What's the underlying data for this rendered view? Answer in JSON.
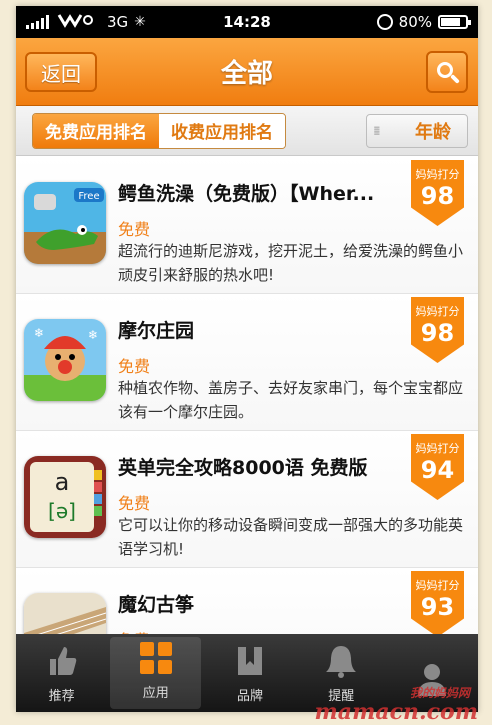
{
  "status_bar": {
    "carrier": "ﾞ",
    "network": "3G",
    "time": "14:28",
    "battery": "80%",
    "battery_level": 0.8
  },
  "header": {
    "back_label": "返回",
    "title": "全部"
  },
  "segments": {
    "free_label": "免费应用排名",
    "paid_label": "收费应用排名",
    "age_label": "年龄"
  },
  "apps": [
    {
      "name": "鳄鱼洗澡（免费版）【Wher...",
      "price": "免费",
      "description": "超流行的迪斯尼游戏，挖开泥土，给爱洗澡的鳄鱼小顽皮引来舒服的热水吧!",
      "score_label": "妈妈打分",
      "score": "98",
      "icon_badge": "Free"
    },
    {
      "name": "摩尔庄园",
      "price": "免费",
      "description": "种植农作物、盖房子、去好友家串门，每个宝宝都应该有一个摩尔庄园。",
      "score_label": "妈妈打分",
      "score": "98"
    },
    {
      "name": "英单完全攻略8000语 免费版",
      "price": "免费",
      "description": "它可以让你的移动设备瞬间变成一部强大的多功能英语学习机!",
      "score_label": "妈妈打分",
      "score": "94",
      "icon_letter": "a",
      "icon_phonetic": "[ə]"
    },
    {
      "name": "魔幻古筝",
      "price": "免费",
      "description": "",
      "score_label": "妈妈打分",
      "score": "93"
    }
  ],
  "tabs": [
    {
      "label": "推荐",
      "icon": "thumbs-up-icon"
    },
    {
      "label": "应用",
      "icon": "grid-icon"
    },
    {
      "label": "品牌",
      "icon": "book-icon"
    },
    {
      "label": "提醒",
      "icon": "bell-icon"
    },
    {
      "label": "",
      "icon": "person-icon"
    }
  ],
  "watermark": {
    "text": "mamacn.com",
    "sub": "我的妈妈网"
  },
  "colors": {
    "accent": "#f7890f",
    "price": "#f08019"
  }
}
